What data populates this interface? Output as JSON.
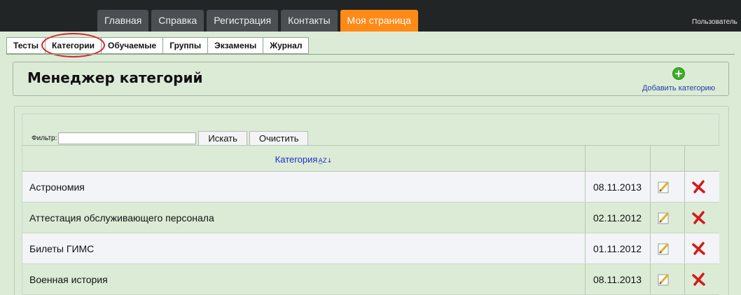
{
  "topnav": {
    "tabs": [
      {
        "label": "Главная"
      },
      {
        "label": "Справка"
      },
      {
        "label": "Регистрация"
      },
      {
        "label": "Контакты"
      },
      {
        "label": "Моя страница",
        "active": true
      }
    ],
    "user_label": "Пользователь"
  },
  "subtabs": {
    "items": [
      {
        "label": "Тесты"
      },
      {
        "label": "Категории",
        "active": true
      },
      {
        "label": "Обучаемые"
      },
      {
        "label": "Группы"
      },
      {
        "label": "Экзамены"
      },
      {
        "label": "Журнал"
      }
    ]
  },
  "manager": {
    "title": "Менеджер категорий",
    "add_label": "Добавить категорию",
    "add_icon": "plus-icon"
  },
  "filter": {
    "label": "Фильтр:",
    "value": "",
    "search_label": "Искать",
    "clear_label": "Очистить"
  },
  "table": {
    "header_category": "Категория",
    "sort_icon": "sort-az-icon",
    "rows": [
      {
        "name": "Астрономия",
        "date": "08.11.2013"
      },
      {
        "name": "Аттестация обслуживающего персонала",
        "date": "02.11.2012"
      },
      {
        "name": "Билеты ГИМС",
        "date": "01.11.2012"
      },
      {
        "name": "Военная история",
        "date": "08.11.2013"
      }
    ]
  },
  "colors": {
    "accent": "#ff8a17",
    "panel_green": "#dcebd6",
    "topbar": "#222526",
    "link": "#1c2fc4"
  }
}
